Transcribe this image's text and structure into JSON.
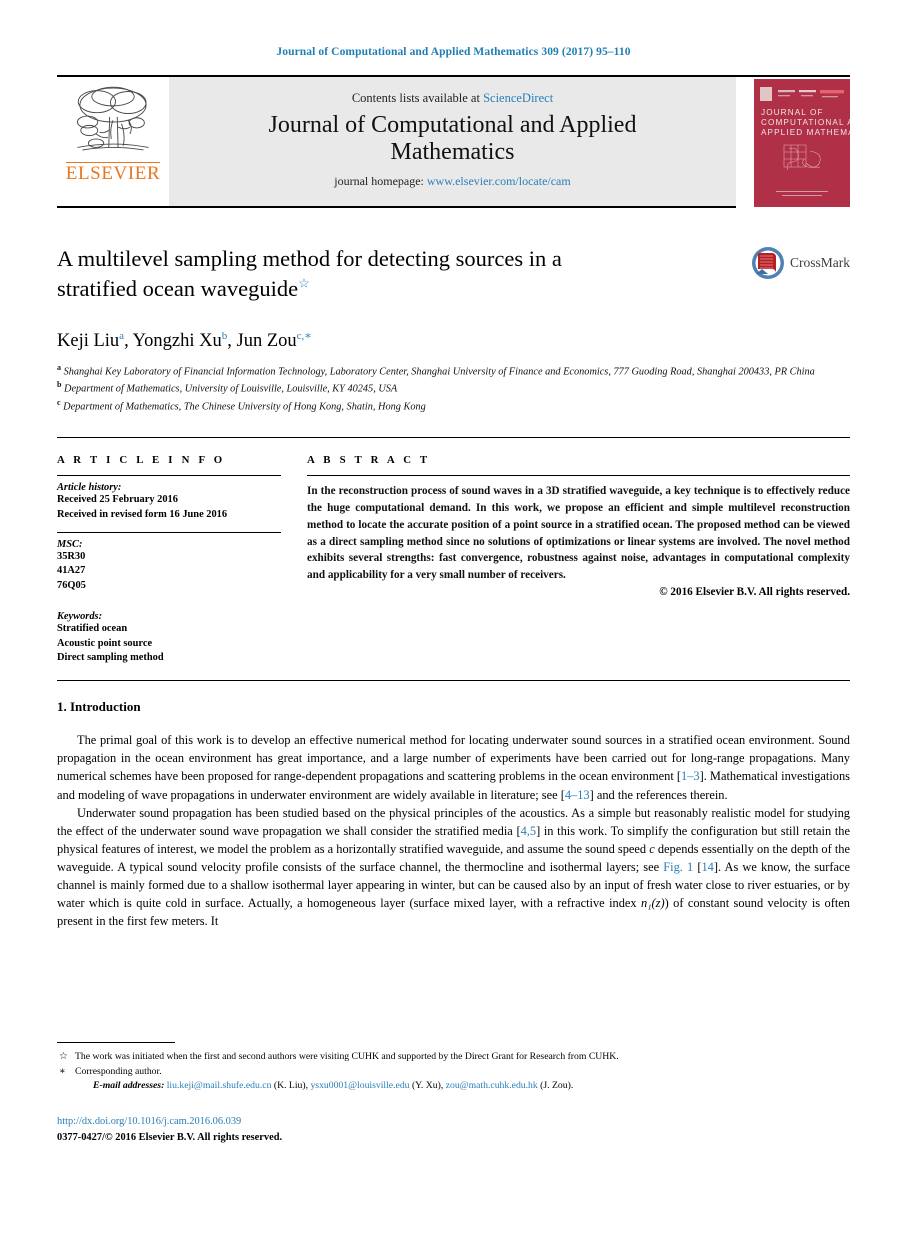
{
  "running_head": "Journal of Computational and Applied Mathematics 309 (2017) 95–110",
  "masthead": {
    "publisher_name": "ELSEVIER",
    "contents_prefix": "Contents lists available at ",
    "contents_link": "ScienceDirect",
    "journal_name_line1": "Journal of Computational and Applied",
    "journal_name_line2": "Mathematics",
    "homepage_prefix": "journal homepage: ",
    "homepage_url": "www.elsevier.com/locate/cam",
    "cover_title_line1": "JOURNAL OF",
    "cover_title_line2": "COMPUTATIONAL AND",
    "cover_title_line3": "APPLIED MATHEMATICS"
  },
  "article": {
    "title_line1": "A multilevel sampling method for detecting sources in a",
    "title_line2": "stratified ocean waveguide",
    "title_star": "☆",
    "crossmark_label": "CrossMark",
    "authors": [
      {
        "name": "Keji Liu",
        "sup": "a",
        "sep": ", "
      },
      {
        "name": "Yongzhi Xu",
        "sup": "b",
        "sep": ", "
      },
      {
        "name": "Jun Zou",
        "sup": "c,∗",
        "sep": ""
      }
    ],
    "affiliations": [
      {
        "marker": "a",
        "text": "Shanghai Key Laboratory of Financial Information Technology, Laboratory Center, Shanghai University of Finance and Economics, 777 Guoding Road, Shanghai 200433, PR China"
      },
      {
        "marker": "b",
        "text": "Department of Mathematics, University of Louisville, Louisville, KY 40245, USA"
      },
      {
        "marker": "c",
        "text": "Department of Mathematics, The Chinese University of Hong Kong, Shatin, Hong Kong"
      }
    ]
  },
  "article_info": {
    "heading": "A R T I C L E     I N F O",
    "history_label": "Article history:",
    "history_lines": [
      "Received 25 February 2016",
      "Received in revised form 16 June 2016"
    ],
    "msc_label": "MSC:",
    "msc_codes": [
      "35R30",
      "41A27",
      "76Q05"
    ],
    "keywords_label": "Keywords:",
    "keywords": [
      "Stratified ocean",
      "Acoustic point source",
      "Direct sampling method"
    ]
  },
  "abstract": {
    "heading": "A B S T R A C T",
    "text": "In the reconstruction process of sound waves in a 3D stratified waveguide, a key technique is to effectively reduce the huge computational demand. In this work, we propose an efficient and simple multilevel reconstruction method to locate the accurate position of a point source in a stratified ocean. The proposed method can be viewed as a direct sampling method since no solutions of optimizations or linear systems are involved. The novel method exhibits several strengths: fast convergence, robustness against noise, advantages in computational complexity and applicability for a very small number of receivers.",
    "copyright": "© 2016 Elsevier B.V. All rights reserved."
  },
  "introduction": {
    "heading": "1. Introduction",
    "paragraph1_a": "The primal goal of this work is to develop an effective numerical method for locating underwater sound sources in a stratified ocean environment. Sound propagation in the ocean environment has great importance, and a large number of experiments have been carried out for long-range propagations. Many numerical schemes have been proposed for range-dependent propagations and scattering problems in the ocean environment [",
    "paragraph1_ref1": "1–3",
    "paragraph1_b": "]. Mathematical investigations and modeling of wave propagations in underwater environment are widely available in literature; see [",
    "paragraph1_ref2": "4–13",
    "paragraph1_c": "] and the references therein.",
    "paragraph2_a": "Underwater sound propagation has been studied based on the physical principles of the acoustics. As a simple but reasonably realistic model for studying the effect of the underwater sound wave propagation we shall consider the stratified media [",
    "paragraph2_ref1": "4,5",
    "paragraph2_b": "] in this work. To simplify the configuration but still retain the physical features of interest, we model the problem as a horizontally stratified waveguide, and assume the sound speed ",
    "paragraph2_var": "c",
    "paragraph2_c": " depends essentially on the depth of the waveguide. A typical sound velocity profile consists of the surface channel, the thermocline and isothermal layers; see ",
    "paragraph2_figref": "Fig. 1",
    "paragraph2_d": " [",
    "paragraph2_ref2": "14",
    "paragraph2_e": "]. As we know, the surface channel is mainly formed due to a shallow isothermal layer appearing in winter, but can be caused also by an input of fresh water close to river estuaries, or by water which is quite cold in surface. Actually, a homogeneous layer (surface mixed layer, with a refractive index ",
    "paragraph2_math": "n₁(z)",
    "paragraph2_f": ") of constant sound velocity is often present in the first few meters. It"
  },
  "footnotes": {
    "star_marker": "☆",
    "star_text": "The work was initiated when the first and second authors were visiting CUHK and supported by the Direct Grant for Research from CUHK.",
    "corr_marker": "∗",
    "corr_text": "Corresponding author.",
    "email_label": "E-mail addresses:",
    "emails": [
      {
        "address": "liu.keji@mail.shufe.edu.cn",
        "who": " (K. Liu), "
      },
      {
        "address": "ysxu0001@louisville.edu",
        "who": " (Y. Xu), "
      },
      {
        "address": "zou@math.cuhk.edu.hk",
        "who": " (J. Zou)."
      }
    ],
    "doi": "http://dx.doi.org/10.1016/j.cam.2016.06.039",
    "issn_line": "0377-0427/© 2016 Elsevier B.V. All rights reserved."
  },
  "colors": {
    "link_blue": "#2a7fb8",
    "elsevier_orange": "#E87722",
    "cover_red": "#b03048",
    "masthead_grey": "#e9e9e9"
  }
}
